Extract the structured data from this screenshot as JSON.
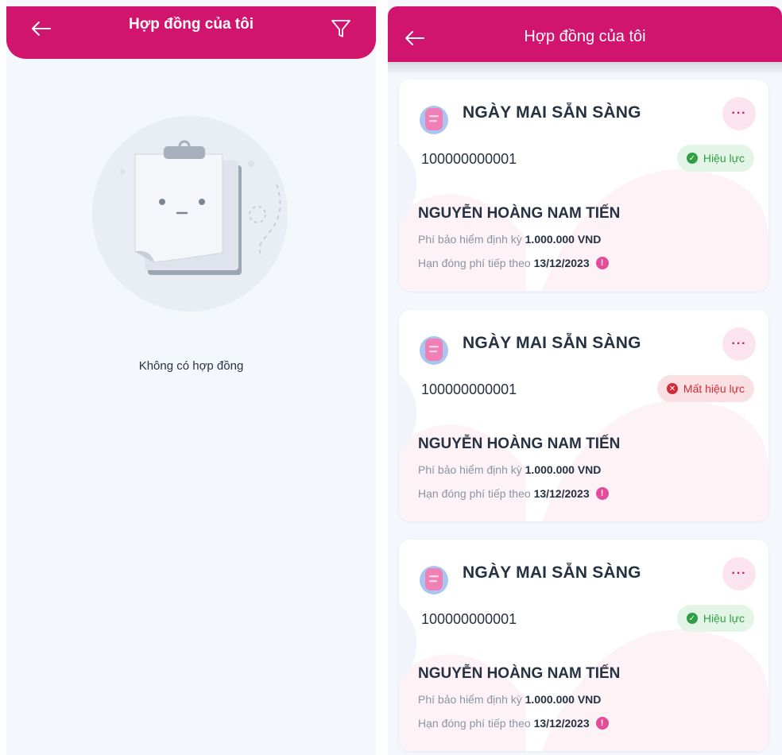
{
  "left_screen": {
    "header": {
      "title": "Hợp đồng của tôi",
      "back_icon": "arrow-left-icon",
      "filter_icon": "filter-icon"
    },
    "empty_state": {
      "message": "Không có hợp đồng",
      "illustration": "empty-clipboard-icon"
    }
  },
  "right_screen": {
    "header": {
      "title": "Hợp đồng của tôi",
      "back_icon": "arrow-left-icon"
    },
    "contracts": [
      {
        "product_name": "NGÀY MAI SẴN SÀNG",
        "contract_number": "100000000001",
        "status": "Hiệu lực",
        "status_type": "active",
        "holder_name": "NGUYỄN HOÀNG NAM TIẾN",
        "premium_label": "Phí bảo hiểm định kỳ",
        "premium_value": "1.000.000 VND",
        "due_label": "Hạn đóng phí tiếp theo",
        "due_value": "13/12/2023",
        "more_label": "···"
      },
      {
        "product_name": "NGÀY MAI SẴN SÀNG",
        "contract_number": "100000000001",
        "status": "Mất hiệu lực",
        "status_type": "inactive",
        "holder_name": "NGUYỄN HOÀNG NAM TIẾN",
        "premium_label": "Phí bảo hiểm định kỳ",
        "premium_value": "1.000.000 VND",
        "due_label": "Hạn đóng phí tiếp theo",
        "due_value": "13/12/2023",
        "more_label": "···"
      },
      {
        "product_name": "NGÀY MAI SẴN SÀNG",
        "contract_number": "100000000001",
        "status": "Hiệu lực",
        "status_type": "active",
        "holder_name": "NGUYỄN HOÀNG NAM TIẾN",
        "premium_label": "Phí bảo hiểm định kỳ",
        "premium_value": "1.000.000 VND",
        "due_label": "Hạn đóng phí tiếp theo",
        "due_value": "13/12/2023",
        "more_label": "···"
      }
    ]
  },
  "colors": {
    "brand": "#d1146d",
    "background": "#f4f7fc",
    "active": "#2f9e44",
    "inactive": "#d12b3a"
  }
}
